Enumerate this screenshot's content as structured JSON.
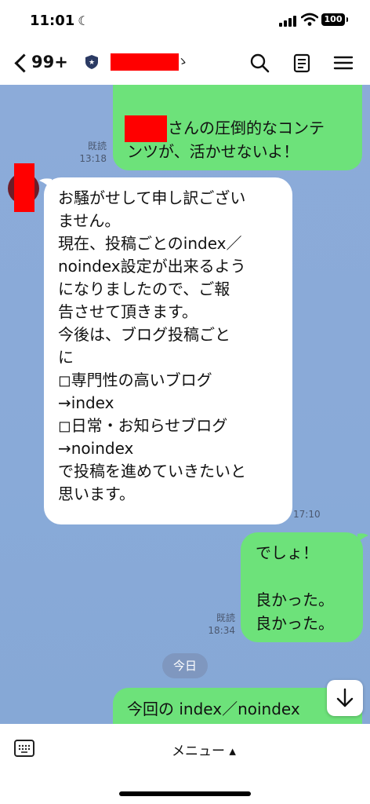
{
  "status_bar": {
    "time": "11:01",
    "battery": "100"
  },
  "header": {
    "unread_count": "99+",
    "name_tail": "ゝ"
  },
  "messages": {
    "top_sent": {
      "line1": "さんの圧倒的なコンテ",
      "line2": "ンツが、活かせないよ！",
      "read": "既読",
      "time": "13:18"
    },
    "received": {
      "lines": [
        "お騒がせして申し訳ござい",
        "ません。",
        "現在、投稿ごとのindex／",
        "noindex設定が出来るよう",
        "になりましたので、ご報",
        "告させて頂きます。",
        "今後は、ブログ投稿ごと",
        "に",
        "◻︎専門性の高いブログ",
        "→index",
        "◻︎日常・お知らせブログ",
        "→noindex",
        "で投稿を進めていきたいと",
        "思います。"
      ],
      "time": "17:10"
    },
    "sent_2": {
      "lines": [
        "でしょ！",
        "",
        "良かった。",
        "良かった。"
      ],
      "read": "既読",
      "time": "18:34"
    },
    "date_divider": "今日",
    "bottom_sent": {
      "line1": "今回の index／noindex"
    }
  },
  "bottom_bar": {
    "menu_label": "メニュー ▴"
  }
}
